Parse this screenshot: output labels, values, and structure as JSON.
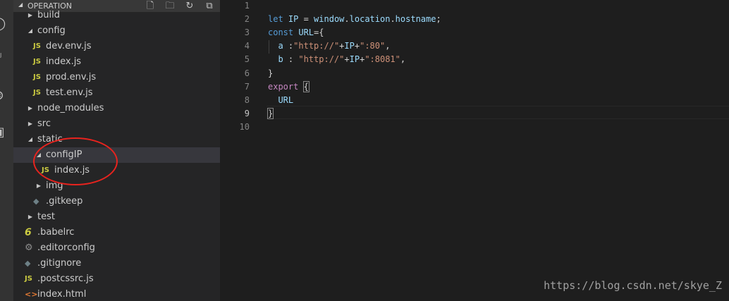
{
  "explorer": {
    "title": "OPERATION",
    "header_icons": [
      "new-file-icon",
      "new-folder-icon",
      "refresh-icon",
      "collapse-all-icon"
    ],
    "items": [
      {
        "label": "build",
        "kind": "folder",
        "expanded": false,
        "depth": 1
      },
      {
        "label": "config",
        "kind": "folder",
        "expanded": true,
        "depth": 1
      },
      {
        "label": "dev.env.js",
        "kind": "js",
        "depth": 2
      },
      {
        "label": "index.js",
        "kind": "js",
        "depth": 2
      },
      {
        "label": "prod.env.js",
        "kind": "js",
        "depth": 2
      },
      {
        "label": "test.env.js",
        "kind": "js",
        "depth": 2
      },
      {
        "label": "node_modules",
        "kind": "folder",
        "expanded": false,
        "depth": 1
      },
      {
        "label": "src",
        "kind": "folder",
        "expanded": false,
        "depth": 1
      },
      {
        "label": "static",
        "kind": "folder",
        "expanded": true,
        "depth": 1
      },
      {
        "label": "configIP",
        "kind": "folder",
        "expanded": true,
        "depth": 2,
        "selected": true
      },
      {
        "label": "index.js",
        "kind": "js",
        "depth": 3
      },
      {
        "label": "img",
        "kind": "folder",
        "expanded": false,
        "depth": 2
      },
      {
        "label": ".gitkeep",
        "kind": "git",
        "depth": 2
      },
      {
        "label": "test",
        "kind": "folder",
        "expanded": false,
        "depth": 1
      },
      {
        "label": ".babelrc",
        "kind": "babel",
        "depth": 1
      },
      {
        "label": ".editorconfig",
        "kind": "cfg",
        "depth": 1
      },
      {
        "label": ".gitignore",
        "kind": "git",
        "depth": 1
      },
      {
        "label": ".postcssrc.js",
        "kind": "js",
        "depth": 1
      },
      {
        "label": "index.html",
        "kind": "html",
        "depth": 1
      }
    ],
    "file_badges": {
      "js": "JS",
      "babel": "6",
      "cfg": "⚙",
      "git": "◆",
      "html": "<>"
    }
  },
  "editor": {
    "line_numbers": [
      "1",
      "2",
      "3",
      "4",
      "5",
      "6",
      "7",
      "8",
      "9",
      "10"
    ],
    "current_line": 9,
    "lines": [
      [],
      [
        {
          "t": "let ",
          "c": "kw"
        },
        {
          "t": "IP",
          "c": "var"
        },
        {
          "t": " = ",
          "c": "br"
        },
        {
          "t": "window",
          "c": "var"
        },
        {
          "t": ".",
          "c": "br"
        },
        {
          "t": "location",
          "c": "var"
        },
        {
          "t": ".",
          "c": "br"
        },
        {
          "t": "hostname",
          "c": "var"
        },
        {
          "t": ";",
          "c": "br"
        }
      ],
      [
        {
          "t": "const ",
          "c": "kw"
        },
        {
          "t": "URL",
          "c": "var"
        },
        {
          "t": "={",
          "c": "br"
        }
      ],
      [
        {
          "t": "  a ",
          "c": "var"
        },
        {
          "t": ":",
          "c": "br"
        },
        {
          "t": "\"http://\"",
          "c": "str"
        },
        {
          "t": "+",
          "c": "br"
        },
        {
          "t": "IP",
          "c": "var"
        },
        {
          "t": "+",
          "c": "br"
        },
        {
          "t": "\":80\"",
          "c": "str"
        },
        {
          "t": ",",
          "c": "br"
        }
      ],
      [
        {
          "t": "  b ",
          "c": "var"
        },
        {
          "t": ": ",
          "c": "br"
        },
        {
          "t": "\"http://\"",
          "c": "str"
        },
        {
          "t": "+",
          "c": "br"
        },
        {
          "t": "IP",
          "c": "var"
        },
        {
          "t": "+",
          "c": "br"
        },
        {
          "t": "\":8081\"",
          "c": "str"
        },
        {
          "t": ",",
          "c": "br"
        }
      ],
      [
        {
          "t": "}",
          "c": "br"
        }
      ],
      [
        {
          "t": "export ",
          "c": "kw2"
        },
        {
          "t": "{",
          "c": "br brmatch"
        }
      ],
      [
        {
          "t": "  URL",
          "c": "var"
        }
      ],
      [
        {
          "t": "}",
          "c": "br brmatch"
        }
      ],
      []
    ]
  },
  "annotation": {
    "color": "#e8231e"
  },
  "watermark": "https://blog.csdn.net/skye_Z"
}
